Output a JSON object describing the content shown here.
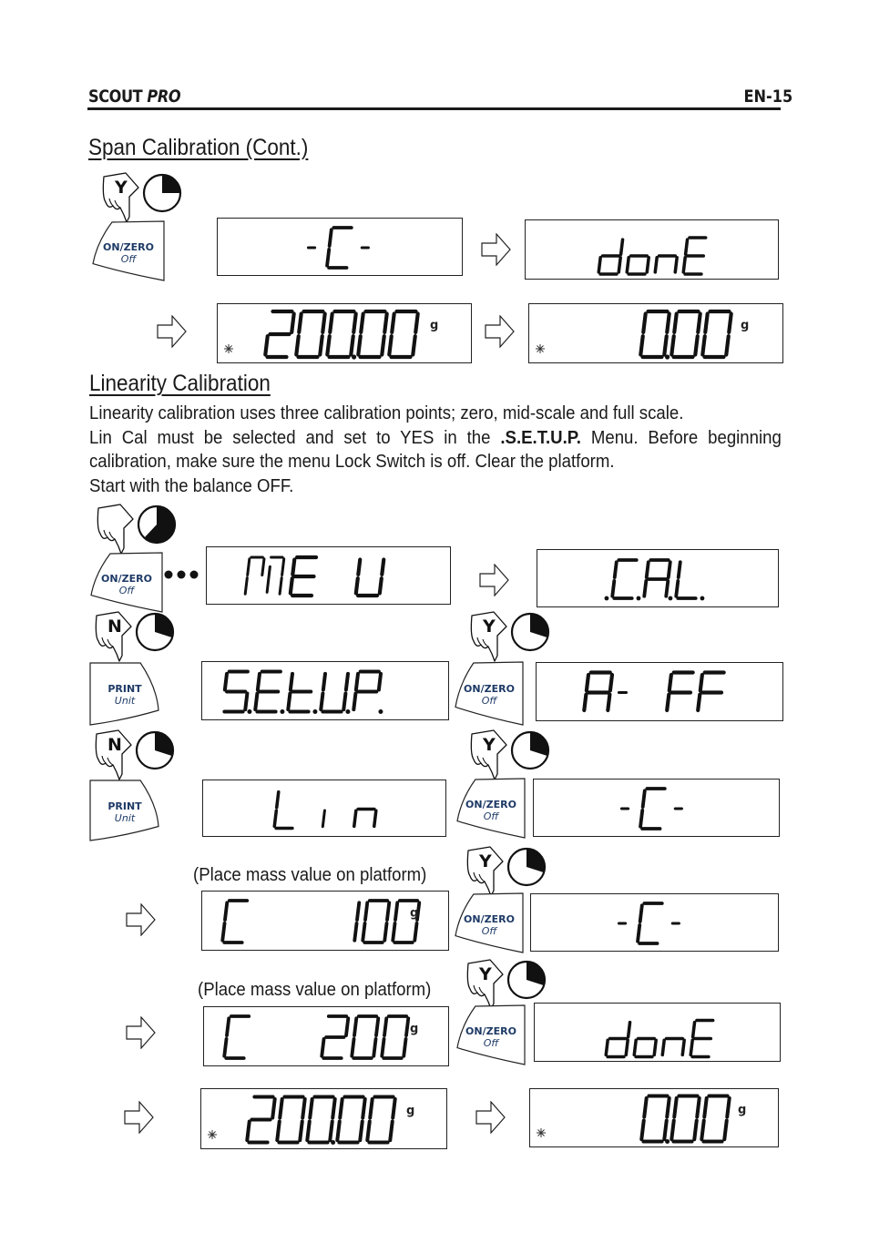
{
  "header": {
    "product_brand": "SCOUT",
    "product_model": "PRO",
    "page_number": "EN-15"
  },
  "span_section": {
    "title": "Span Calibration (Cont.)",
    "steps": {
      "hand_letter": "Y",
      "key": {
        "top": "ON/ZERO",
        "bottom": "Off"
      },
      "displays": [
        {
          "id": "span-c",
          "text": "-C-",
          "unit": "",
          "stable": false
        },
        {
          "id": "span-done",
          "text": "donE",
          "unit": "",
          "stable": false
        },
        {
          "id": "span-200",
          "text": "200.00",
          "unit": "g",
          "stable": true
        },
        {
          "id": "span-zero",
          "text": "0.00",
          "unit": "g",
          "stable": true
        }
      ]
    }
  },
  "linearity_section": {
    "title": "Linearity Calibration",
    "paragraph": [
      "Linearity calibration uses three calibration points; zero, mid-scale and full scale.",
      "Lin Cal must be selected and set to YES in the",
      ".S.E.T.U.P.",
      "Menu.  Before beginning",
      "calibration, make sure the menu Lock Switch is off.   Clear the platform.",
      "Start with the balance OFF."
    ],
    "keys": {
      "onzero": {
        "top": "ON/ZERO",
        "bottom": "Off"
      },
      "print": {
        "top": "PRINT",
        "bottom": "Unit"
      }
    },
    "hand_letters": {
      "yes": "Y",
      "no": "N"
    },
    "place_mass_note": "(Place mass value on platform)",
    "displays": [
      {
        "id": "menu",
        "text": "MENU",
        "unit": ""
      },
      {
        "id": "cal",
        "text": ".C.A.L.",
        "unit": ""
      },
      {
        "id": "setup",
        "text": "S.E.t.U.P.",
        "unit": ""
      },
      {
        "id": "aoff",
        "text": "A-OFF",
        "unit": ""
      },
      {
        "id": "lin",
        "text": "Lin",
        "unit": ""
      },
      {
        "id": "lin-c1",
        "text": "-C-",
        "unit": ""
      },
      {
        "id": "c100",
        "text": "C 100",
        "unit": "g"
      },
      {
        "id": "lin-c2",
        "text": "-C-",
        "unit": ""
      },
      {
        "id": "c200",
        "text": "C 200",
        "unit": "g"
      },
      {
        "id": "lin-done",
        "text": "donE",
        "unit": ""
      },
      {
        "id": "lin-200",
        "text": "200.00",
        "unit": "g",
        "stable": true
      },
      {
        "id": "lin-zero",
        "text": "0.00",
        "unit": "g",
        "stable": true
      }
    ]
  }
}
